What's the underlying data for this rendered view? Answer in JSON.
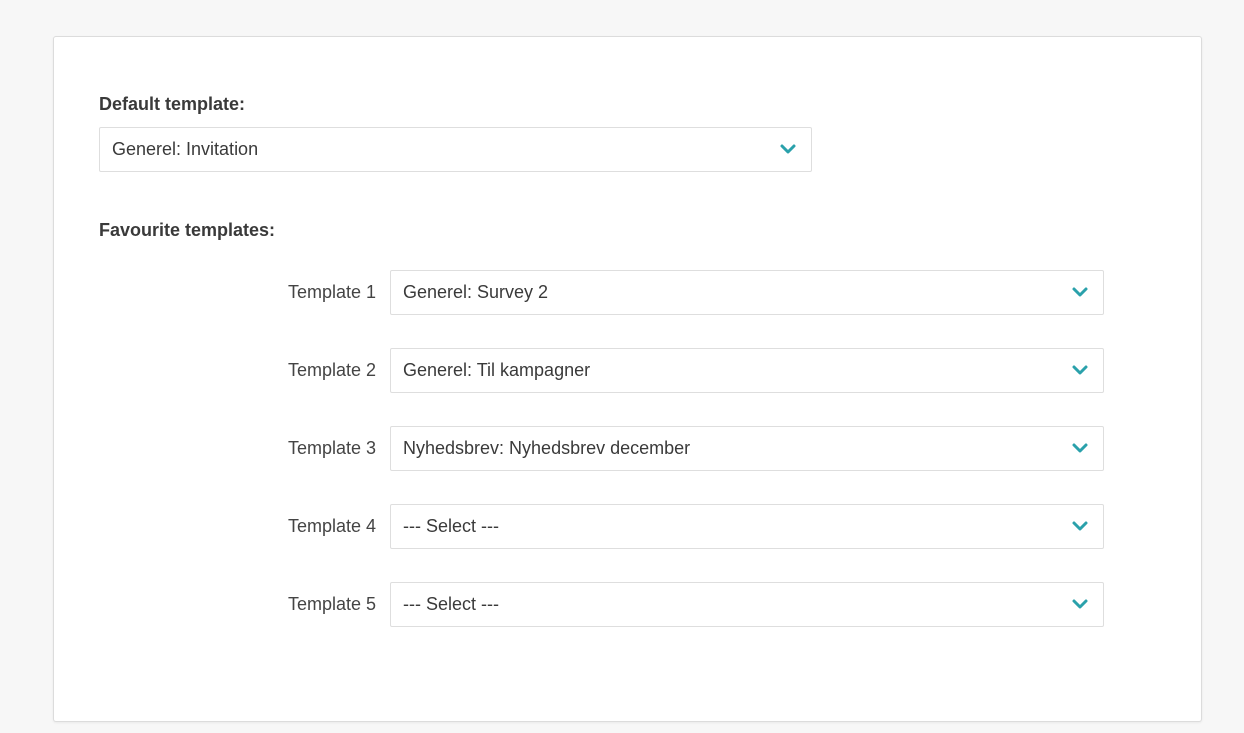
{
  "colors": {
    "accent": "#2aa1ab",
    "panel_border": "#dcdcdc",
    "field_border": "#dedede",
    "text": "#3a3a3a"
  },
  "default_template": {
    "heading": "Default template:",
    "value": "Generel: Invitation",
    "icon": "chevron-down-icon"
  },
  "favourite_templates": {
    "heading": "Favourite templates:",
    "rows": [
      {
        "label": "Template 1",
        "value": "Generel: Survey 2"
      },
      {
        "label": "Template 2",
        "value": "Generel: Til kampagner"
      },
      {
        "label": "Template 3",
        "value": "Nyhedsbrev: Nyhedsbrev december"
      },
      {
        "label": "Template 4",
        "value": "--- Select ---"
      },
      {
        "label": "Template 5",
        "value": "--- Select ---"
      }
    ]
  }
}
